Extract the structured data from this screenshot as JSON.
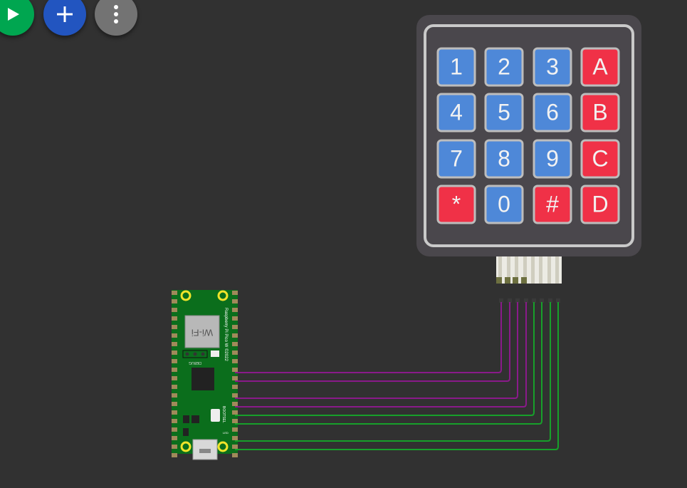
{
  "toolbar": {
    "run": {
      "icon": "play-icon",
      "color": "#00a650"
    },
    "add": {
      "icon": "plus-icon",
      "color": "#2255c0"
    },
    "more": {
      "icon": "more-vertical-icon",
      "color": "#737373"
    }
  },
  "keypad": {
    "keys": [
      {
        "label": "1",
        "kind": "num"
      },
      {
        "label": "2",
        "kind": "num"
      },
      {
        "label": "3",
        "kind": "num"
      },
      {
        "label": "A",
        "kind": "fn"
      },
      {
        "label": "4",
        "kind": "num"
      },
      {
        "label": "5",
        "kind": "num"
      },
      {
        "label": "6",
        "kind": "num"
      },
      {
        "label": "B",
        "kind": "fn"
      },
      {
        "label": "7",
        "kind": "num"
      },
      {
        "label": "8",
        "kind": "num"
      },
      {
        "label": "9",
        "kind": "num"
      },
      {
        "label": "C",
        "kind": "fn"
      },
      {
        "label": "*",
        "kind": "fn"
      },
      {
        "label": "0",
        "kind": "num"
      },
      {
        "label": "#",
        "kind": "fn"
      },
      {
        "label": "D",
        "kind": "fn"
      }
    ],
    "colors": {
      "num": "#4e88d8",
      "fn": "#f03147",
      "body": "#4a474c"
    }
  },
  "pico": {
    "title": "Raspberry Pi Pico W ©2022",
    "wifi_label": "Wi-Fi",
    "debug_label": "DEBUG",
    "bootsel_label": "BOOTSEL",
    "led_label": "LED",
    "board_color": "#0b6e1c"
  },
  "wires": [
    {
      "color": "#8a1a8a"
    },
    {
      "color": "#8a1a8a"
    },
    {
      "color": "#8a1a8a"
    },
    {
      "color": "#8a1a8a"
    },
    {
      "color": "#17a02a"
    },
    {
      "color": "#17a02a"
    },
    {
      "color": "#17a02a"
    },
    {
      "color": "#17a02a"
    }
  ]
}
